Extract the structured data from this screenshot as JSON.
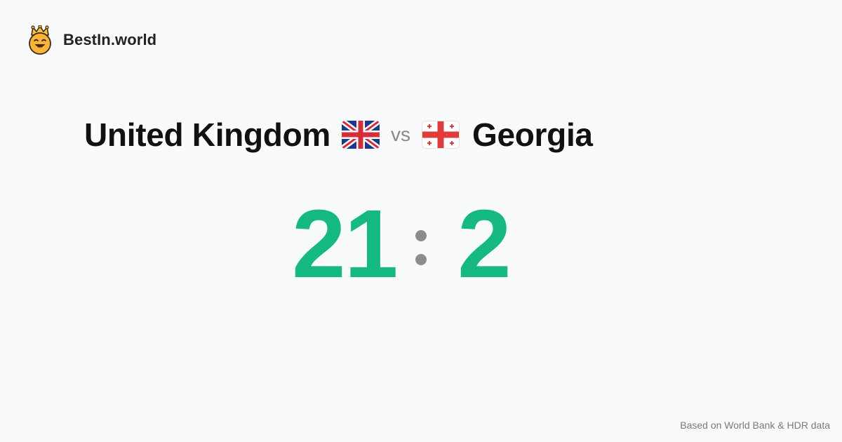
{
  "brand": {
    "name": "BestIn.world",
    "logo_icon": "crown-smiley-icon"
  },
  "comparison": {
    "left_country": "United Kingdom",
    "left_flag": "uk-flag-icon",
    "vs_label": "vs",
    "right_country": "Georgia",
    "right_flag": "georgia-flag-icon"
  },
  "score": {
    "left": "21",
    "right": "2",
    "color": "#16b981",
    "separator_color": "#8c8c8c"
  },
  "footer": {
    "source_note": "Based on World Bank & HDR data"
  }
}
